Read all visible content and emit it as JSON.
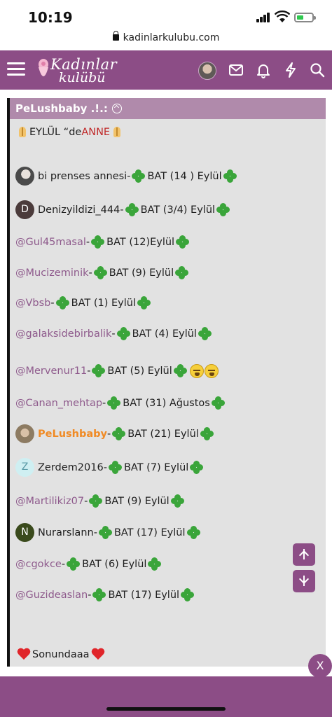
{
  "status_bar": {
    "time": "10:19"
  },
  "browser": {
    "url": "kadinlarkulubu.com"
  },
  "header": {
    "logo_line1": "Kadınlar",
    "logo_line2": "kulübü",
    "icons": [
      "menu-icon",
      "avatar",
      "mail-icon",
      "bell-icon",
      "bolt-icon",
      "search-icon"
    ],
    "brand_color": "#8c4d86"
  },
  "post": {
    "author": "PeLushbaby .!.:",
    "title_pre": "EYLÜL “de ",
    "title_highlight": "ANNE",
    "entries": [
      {
        "name": "bi prenses annesi",
        "type": "user",
        "avatar": "photo",
        "text": "BAT (14 ) Eylül"
      },
      {
        "name": "Denizyildizi_444",
        "type": "user",
        "avatar": "D",
        "text": "BAT (3/4) Eylül"
      },
      {
        "name": "@Gul45masal",
        "type": "mention",
        "text": "BAT (12)Eylül"
      },
      {
        "name": "@Mucizeminik",
        "type": "mention",
        "text": "BAT (9) Eylül"
      },
      {
        "name": "@Vbsb",
        "type": "mention",
        "text": "BAT (1) Eylül"
      },
      {
        "name": "@galaksidebirbalik",
        "type": "mention",
        "text": "BAT (4) Eylül"
      },
      {
        "name": "@Mervenur11",
        "type": "mention",
        "text": "BAT (5) Eylül"
      },
      {
        "name": "@Canan_mehtap",
        "type": "mention",
        "text": "BAT (31) Ağustos"
      },
      {
        "name": "PeLushbaby",
        "type": "user-highlight",
        "avatar": "photo",
        "text": "BAT (21) Eylül"
      },
      {
        "name": "Zerdem2016",
        "type": "user",
        "avatar": "Z",
        "text": "BAT (7) Eylül"
      },
      {
        "name": "@Martilikiz07",
        "type": "mention",
        "text": "BAT (9) Eylül"
      },
      {
        "name": "Nurarslann",
        "type": "user",
        "avatar": "N",
        "text": "BAT (17) Eylül"
      },
      {
        "name": "@cgokce",
        "type": "mention",
        "text": "BAT (6) Eylül"
      },
      {
        "name": "@Guzideaslan",
        "type": "mention",
        "text": "BAT (17) Eylül"
      }
    ],
    "footer_text": "Sonundaaa"
  },
  "separator": " - ",
  "close_label": "X"
}
